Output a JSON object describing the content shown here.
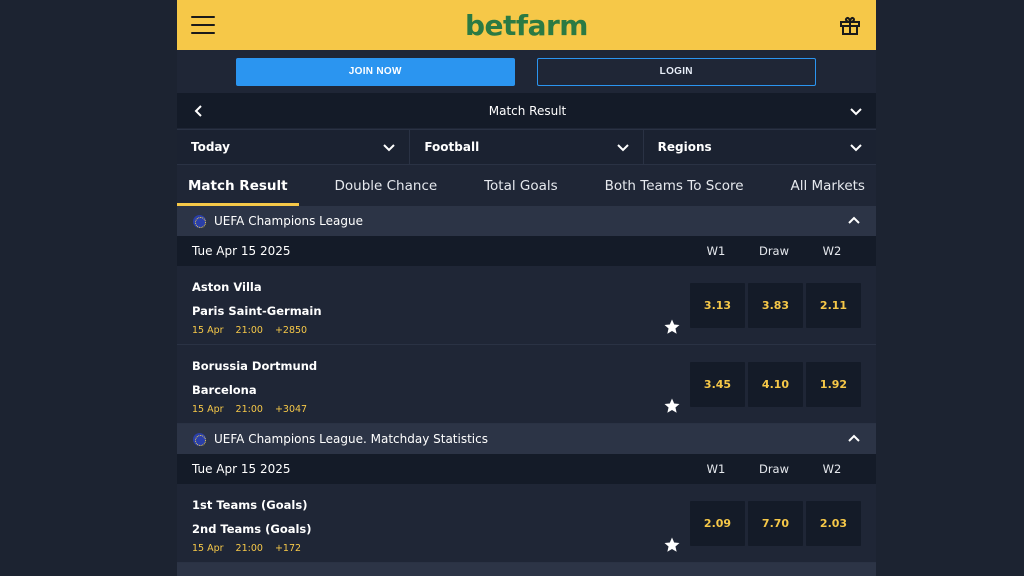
{
  "header": {
    "logo": "betfarm"
  },
  "auth": {
    "join_label": "JOIN NOW",
    "login_label": "LOGIN"
  },
  "market": {
    "title": "Match Result"
  },
  "filters": [
    {
      "label": "Today"
    },
    {
      "label": "Football"
    },
    {
      "label": "Regions"
    }
  ],
  "tabs": [
    {
      "label": "Match Result"
    },
    {
      "label": "Double Chance"
    },
    {
      "label": "Total Goals"
    },
    {
      "label": "Both Teams To Score"
    },
    {
      "label": "All Markets"
    }
  ],
  "leagues": [
    {
      "name": "UEFA Champions League",
      "date": "Tue Apr 15 2025",
      "cols": [
        "W1",
        "Draw",
        "W2"
      ],
      "matches": [
        {
          "home": "Aston Villa",
          "away": "Paris Saint-Germain",
          "day": "15 Apr",
          "time": "21:00",
          "more": "+2850",
          "odds": [
            "3.13",
            "3.83",
            "2.11"
          ]
        },
        {
          "home": "Borussia Dortmund",
          "away": "Barcelona",
          "day": "15 Apr",
          "time": "21:00",
          "more": "+3047",
          "odds": [
            "3.45",
            "4.10",
            "1.92"
          ]
        }
      ]
    },
    {
      "name": "UEFA Champions League. Matchday Statistics",
      "date": "Tue Apr 15 2025",
      "cols": [
        "W1",
        "Draw",
        "W2"
      ],
      "matches": [
        {
          "home": "1st Teams (Goals)",
          "away": "2nd Teams (Goals)",
          "day": "15 Apr",
          "time": "21:00",
          "more": "+172",
          "odds": [
            "2.09",
            "7.70",
            "2.03"
          ]
        }
      ]
    }
  ],
  "colors": {
    "accent": "#f6c848",
    "brand_green": "#2b7a43",
    "primary_blue": "#2b95f0"
  }
}
